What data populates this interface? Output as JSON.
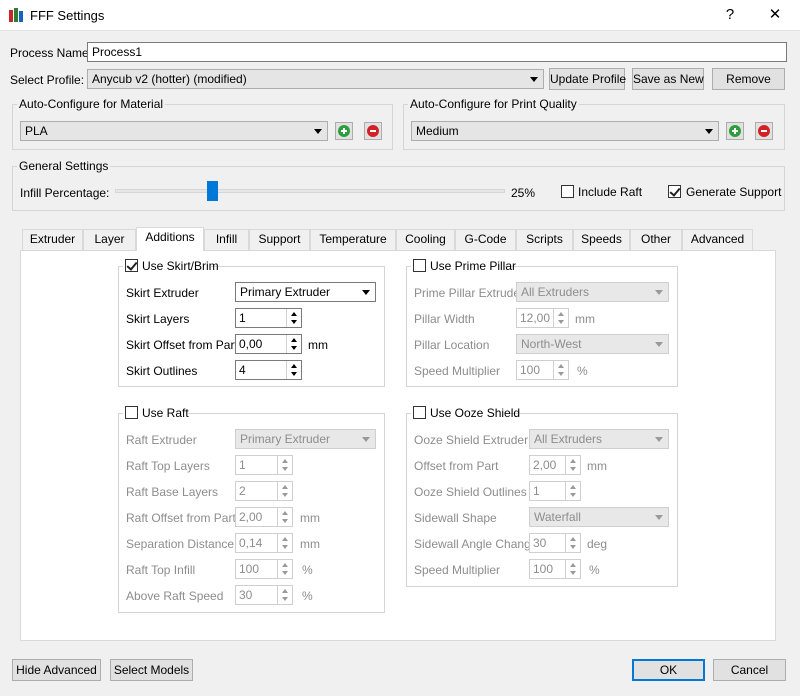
{
  "window": {
    "title": "FFF Settings",
    "help": "?",
    "close": "✕"
  },
  "process": {
    "label": "Process Name:",
    "value": "Process1"
  },
  "profile": {
    "label": "Select Profile:",
    "selected": "Anycub v2 (hotter) (modified)",
    "update": "Update Profile",
    "save_as": "Save as New",
    "remove": "Remove"
  },
  "material": {
    "title": "Auto-Configure for Material",
    "selected": "PLA"
  },
  "quality": {
    "title": "Auto-Configure for Print Quality",
    "selected": "Medium"
  },
  "general": {
    "title": "General Settings",
    "infill_label": "Infill Percentage:",
    "infill_value": "25%",
    "infill_fraction": 0.25,
    "include_raft": "Include Raft",
    "include_raft_checked": false,
    "generate_support": "Generate Support",
    "generate_support_checked": true
  },
  "tabs": [
    "Extruder",
    "Layer",
    "Additions",
    "Infill",
    "Support",
    "Temperature",
    "Cooling",
    "G-Code",
    "Scripts",
    "Speeds",
    "Other",
    "Advanced"
  ],
  "active_tab": "Additions",
  "skirt": {
    "title": "Use Skirt/Brim",
    "checked": true,
    "extruder_label": "Skirt Extruder",
    "extruder_value": "Primary Extruder",
    "layers_label": "Skirt Layers",
    "layers_value": "1",
    "offset_label": "Skirt Offset from Part",
    "offset_value": "0,00",
    "offset_unit": "mm",
    "outlines_label": "Skirt Outlines",
    "outlines_value": "4"
  },
  "pillar": {
    "title": "Use Prime Pillar",
    "checked": false,
    "extruder_label": "Prime Pillar Extruder",
    "extruder_value": "All Extruders",
    "width_label": "Pillar Width",
    "width_value": "12,00",
    "width_unit": "mm",
    "location_label": "Pillar Location",
    "location_value": "North-West",
    "speed_label": "Speed Multiplier",
    "speed_value": "100",
    "speed_unit": "%"
  },
  "raft": {
    "title": "Use Raft",
    "checked": false,
    "extruder_label": "Raft Extruder",
    "extruder_value": "Primary Extruder",
    "top_layers_label": "Raft Top Layers",
    "top_layers_value": "1",
    "base_layers_label": "Raft Base Layers",
    "base_layers_value": "2",
    "offset_label": "Raft Offset from Part",
    "offset_value": "2,00",
    "offset_unit": "mm",
    "separation_label": "Separation Distance",
    "separation_value": "0,14",
    "separation_unit": "mm",
    "top_infill_label": "Raft Top Infill",
    "top_infill_value": "100",
    "top_infill_unit": "%",
    "above_speed_label": "Above Raft Speed",
    "above_speed_value": "30",
    "above_speed_unit": "%"
  },
  "ooze": {
    "title": "Use Ooze Shield",
    "checked": false,
    "extruder_label": "Ooze Shield Extruder",
    "extruder_value": "All Extruders",
    "offset_label": "Offset from Part",
    "offset_value": "2,00",
    "offset_unit": "mm",
    "outlines_label": "Ooze Shield Outlines",
    "outlines_value": "1",
    "sidewall_label": "Sidewall Shape",
    "sidewall_value": "Waterfall",
    "angle_label": "Sidewall Angle Change",
    "angle_value": "30",
    "angle_unit": "deg",
    "speed_label": "Speed Multiplier",
    "speed_value": "100",
    "speed_unit": "%"
  },
  "footer": {
    "hide_advanced": "Hide Advanced",
    "select_models": "Select Models",
    "ok": "OK",
    "cancel": "Cancel"
  },
  "colors": {
    "accent": "#0078d7",
    "add": "#2e9e3c",
    "remove": "#d31f26"
  }
}
